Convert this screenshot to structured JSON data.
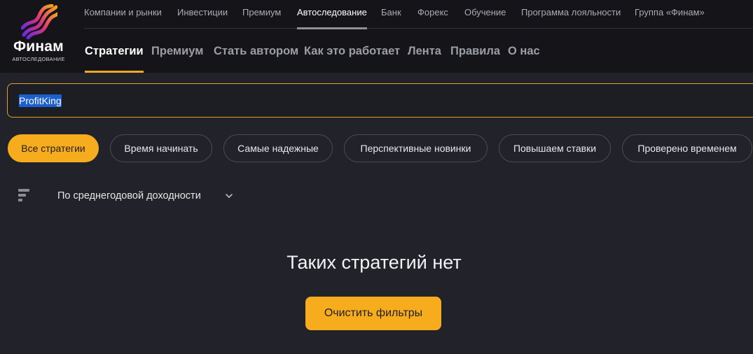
{
  "logo": {
    "name": "Финам",
    "subtitle": "АВТОСЛЕДОВАНИЕ"
  },
  "top_nav": {
    "items": [
      "Компании и рынки",
      "Инвестиции",
      "Премиум",
      "Автоследование",
      "Банк",
      "Форекс",
      "Обучение",
      "Программа лояльности",
      "Группа «Финам»"
    ],
    "active": "Автоследование"
  },
  "sub_nav": {
    "items": [
      "Стратегии",
      "Премиум",
      "Стать автором",
      "Как это работает",
      "Лента",
      "Правила",
      "О нас"
    ],
    "active": "Стратегии"
  },
  "search": {
    "value": "ProfitKing"
  },
  "filters": {
    "chips": [
      "Все стратегии",
      "Время начинать",
      "Самые надежные",
      "Перспективные новинки",
      "Повышаем ставки",
      "Проверено временем"
    ],
    "active": "Все стратегии"
  },
  "sort": {
    "icon": "sort-icon",
    "label": "По среднегодовой доходности",
    "chevron": "chevron-down-icon"
  },
  "empty_state": {
    "title": "Таких стратегий нет",
    "button": "Очистить фильтры"
  },
  "colors": {
    "accent": "#f7ac1d",
    "background": "#22232a",
    "header": "#151519",
    "selection": "#1b5fd0"
  }
}
